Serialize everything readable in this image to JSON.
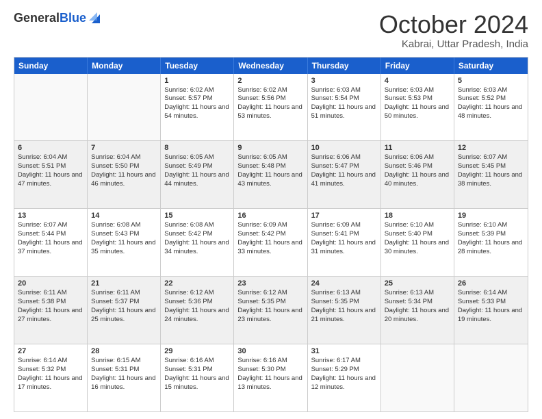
{
  "logo": {
    "general": "General",
    "blue": "Blue"
  },
  "title": "October 2024",
  "location": "Kabrai, Uttar Pradesh, India",
  "header_days": [
    "Sunday",
    "Monday",
    "Tuesday",
    "Wednesday",
    "Thursday",
    "Friday",
    "Saturday"
  ],
  "weeks": [
    [
      {
        "day": "",
        "sunrise": "",
        "sunset": "",
        "daylight": "",
        "shaded": false,
        "empty": true
      },
      {
        "day": "",
        "sunrise": "",
        "sunset": "",
        "daylight": "",
        "shaded": false,
        "empty": true
      },
      {
        "day": "1",
        "sunrise": "Sunrise: 6:02 AM",
        "sunset": "Sunset: 5:57 PM",
        "daylight": "Daylight: 11 hours and 54 minutes.",
        "shaded": false,
        "empty": false
      },
      {
        "day": "2",
        "sunrise": "Sunrise: 6:02 AM",
        "sunset": "Sunset: 5:56 PM",
        "daylight": "Daylight: 11 hours and 53 minutes.",
        "shaded": false,
        "empty": false
      },
      {
        "day": "3",
        "sunrise": "Sunrise: 6:03 AM",
        "sunset": "Sunset: 5:54 PM",
        "daylight": "Daylight: 11 hours and 51 minutes.",
        "shaded": false,
        "empty": false
      },
      {
        "day": "4",
        "sunrise": "Sunrise: 6:03 AM",
        "sunset": "Sunset: 5:53 PM",
        "daylight": "Daylight: 11 hours and 50 minutes.",
        "shaded": false,
        "empty": false
      },
      {
        "day": "5",
        "sunrise": "Sunrise: 6:03 AM",
        "sunset": "Sunset: 5:52 PM",
        "daylight": "Daylight: 11 hours and 48 minutes.",
        "shaded": false,
        "empty": false
      }
    ],
    [
      {
        "day": "6",
        "sunrise": "Sunrise: 6:04 AM",
        "sunset": "Sunset: 5:51 PM",
        "daylight": "Daylight: 11 hours and 47 minutes.",
        "shaded": true,
        "empty": false
      },
      {
        "day": "7",
        "sunrise": "Sunrise: 6:04 AM",
        "sunset": "Sunset: 5:50 PM",
        "daylight": "Daylight: 11 hours and 46 minutes.",
        "shaded": true,
        "empty": false
      },
      {
        "day": "8",
        "sunrise": "Sunrise: 6:05 AM",
        "sunset": "Sunset: 5:49 PM",
        "daylight": "Daylight: 11 hours and 44 minutes.",
        "shaded": true,
        "empty": false
      },
      {
        "day": "9",
        "sunrise": "Sunrise: 6:05 AM",
        "sunset": "Sunset: 5:48 PM",
        "daylight": "Daylight: 11 hours and 43 minutes.",
        "shaded": true,
        "empty": false
      },
      {
        "day": "10",
        "sunrise": "Sunrise: 6:06 AM",
        "sunset": "Sunset: 5:47 PM",
        "daylight": "Daylight: 11 hours and 41 minutes.",
        "shaded": true,
        "empty": false
      },
      {
        "day": "11",
        "sunrise": "Sunrise: 6:06 AM",
        "sunset": "Sunset: 5:46 PM",
        "daylight": "Daylight: 11 hours and 40 minutes.",
        "shaded": true,
        "empty": false
      },
      {
        "day": "12",
        "sunrise": "Sunrise: 6:07 AM",
        "sunset": "Sunset: 5:45 PM",
        "daylight": "Daylight: 11 hours and 38 minutes.",
        "shaded": true,
        "empty": false
      }
    ],
    [
      {
        "day": "13",
        "sunrise": "Sunrise: 6:07 AM",
        "sunset": "Sunset: 5:44 PM",
        "daylight": "Daylight: 11 hours and 37 minutes.",
        "shaded": false,
        "empty": false
      },
      {
        "day": "14",
        "sunrise": "Sunrise: 6:08 AM",
        "sunset": "Sunset: 5:43 PM",
        "daylight": "Daylight: 11 hours and 35 minutes.",
        "shaded": false,
        "empty": false
      },
      {
        "day": "15",
        "sunrise": "Sunrise: 6:08 AM",
        "sunset": "Sunset: 5:42 PM",
        "daylight": "Daylight: 11 hours and 34 minutes.",
        "shaded": false,
        "empty": false
      },
      {
        "day": "16",
        "sunrise": "Sunrise: 6:09 AM",
        "sunset": "Sunset: 5:42 PM",
        "daylight": "Daylight: 11 hours and 33 minutes.",
        "shaded": false,
        "empty": false
      },
      {
        "day": "17",
        "sunrise": "Sunrise: 6:09 AM",
        "sunset": "Sunset: 5:41 PM",
        "daylight": "Daylight: 11 hours and 31 minutes.",
        "shaded": false,
        "empty": false
      },
      {
        "day": "18",
        "sunrise": "Sunrise: 6:10 AM",
        "sunset": "Sunset: 5:40 PM",
        "daylight": "Daylight: 11 hours and 30 minutes.",
        "shaded": false,
        "empty": false
      },
      {
        "day": "19",
        "sunrise": "Sunrise: 6:10 AM",
        "sunset": "Sunset: 5:39 PM",
        "daylight": "Daylight: 11 hours and 28 minutes.",
        "shaded": false,
        "empty": false
      }
    ],
    [
      {
        "day": "20",
        "sunrise": "Sunrise: 6:11 AM",
        "sunset": "Sunset: 5:38 PM",
        "daylight": "Daylight: 11 hours and 27 minutes.",
        "shaded": true,
        "empty": false
      },
      {
        "day": "21",
        "sunrise": "Sunrise: 6:11 AM",
        "sunset": "Sunset: 5:37 PM",
        "daylight": "Daylight: 11 hours and 25 minutes.",
        "shaded": true,
        "empty": false
      },
      {
        "day": "22",
        "sunrise": "Sunrise: 6:12 AM",
        "sunset": "Sunset: 5:36 PM",
        "daylight": "Daylight: 11 hours and 24 minutes.",
        "shaded": true,
        "empty": false
      },
      {
        "day": "23",
        "sunrise": "Sunrise: 6:12 AM",
        "sunset": "Sunset: 5:35 PM",
        "daylight": "Daylight: 11 hours and 23 minutes.",
        "shaded": true,
        "empty": false
      },
      {
        "day": "24",
        "sunrise": "Sunrise: 6:13 AM",
        "sunset": "Sunset: 5:35 PM",
        "daylight": "Daylight: 11 hours and 21 minutes.",
        "shaded": true,
        "empty": false
      },
      {
        "day": "25",
        "sunrise": "Sunrise: 6:13 AM",
        "sunset": "Sunset: 5:34 PM",
        "daylight": "Daylight: 11 hours and 20 minutes.",
        "shaded": true,
        "empty": false
      },
      {
        "day": "26",
        "sunrise": "Sunrise: 6:14 AM",
        "sunset": "Sunset: 5:33 PM",
        "daylight": "Daylight: 11 hours and 19 minutes.",
        "shaded": true,
        "empty": false
      }
    ],
    [
      {
        "day": "27",
        "sunrise": "Sunrise: 6:14 AM",
        "sunset": "Sunset: 5:32 PM",
        "daylight": "Daylight: 11 hours and 17 minutes.",
        "shaded": false,
        "empty": false
      },
      {
        "day": "28",
        "sunrise": "Sunrise: 6:15 AM",
        "sunset": "Sunset: 5:31 PM",
        "daylight": "Daylight: 11 hours and 16 minutes.",
        "shaded": false,
        "empty": false
      },
      {
        "day": "29",
        "sunrise": "Sunrise: 6:16 AM",
        "sunset": "Sunset: 5:31 PM",
        "daylight": "Daylight: 11 hours and 15 minutes.",
        "shaded": false,
        "empty": false
      },
      {
        "day": "30",
        "sunrise": "Sunrise: 6:16 AM",
        "sunset": "Sunset: 5:30 PM",
        "daylight": "Daylight: 11 hours and 13 minutes.",
        "shaded": false,
        "empty": false
      },
      {
        "day": "31",
        "sunrise": "Sunrise: 6:17 AM",
        "sunset": "Sunset: 5:29 PM",
        "daylight": "Daylight: 11 hours and 12 minutes.",
        "shaded": false,
        "empty": false
      },
      {
        "day": "",
        "sunrise": "",
        "sunset": "",
        "daylight": "",
        "shaded": false,
        "empty": true
      },
      {
        "day": "",
        "sunrise": "",
        "sunset": "",
        "daylight": "",
        "shaded": false,
        "empty": true
      }
    ]
  ]
}
